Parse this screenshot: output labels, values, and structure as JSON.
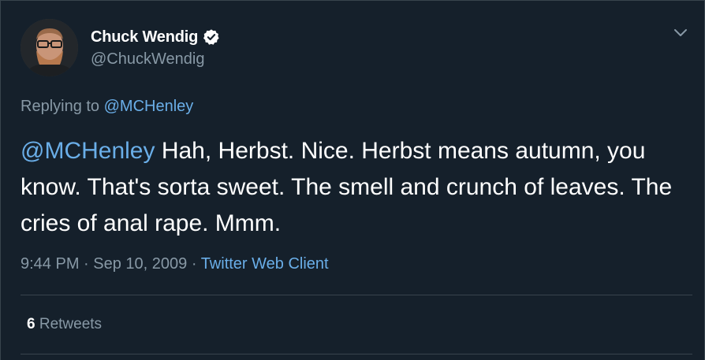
{
  "author": {
    "display_name": "Chuck Wendig",
    "handle": "@ChuckWendig",
    "verified": true
  },
  "reply": {
    "prefix": "Replying to",
    "mention": "@MCHenley"
  },
  "tweet": {
    "mention": "@MCHenley",
    "text": " Hah, Herbst. Nice. Herbst means autumn, you know. That's sorta sweet. The smell and crunch of leaves. The cries of anal rape. Mmm."
  },
  "meta": {
    "time": "9:44 PM",
    "sep1": " · ",
    "date": "Sep 10, 2009",
    "sep2": " · ",
    "source": "Twitter Web Client"
  },
  "stats": {
    "retweet_count": "6",
    "retweet_label": " Retweets"
  },
  "icons": {
    "verified": "verified-badge-icon",
    "caret": "chevron-down-icon"
  },
  "colors": {
    "background": "#15202b",
    "link": "#6aaee8",
    "secondary_text": "#8899a6",
    "divider": "#38444d"
  }
}
